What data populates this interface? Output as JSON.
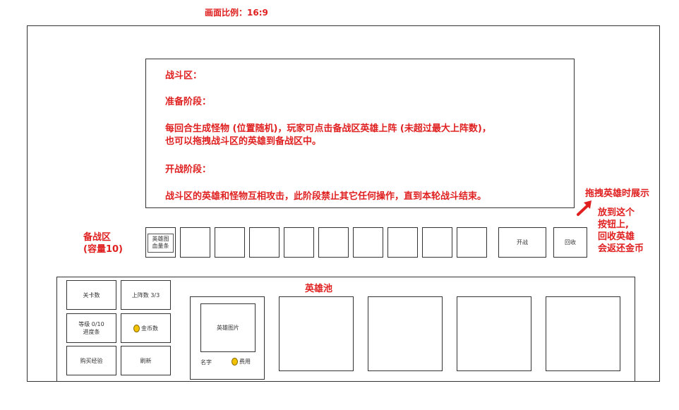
{
  "aspect_note": "画面比例：16:9",
  "battle_area": {
    "title": "战斗区：",
    "prep_heading": "准备阶段：",
    "prep_line1": "每回合生成怪物 (位置随机)，玩家可点击备战区英雄上阵 (未超过最大上阵数)，",
    "prep_line2": "也可以拖拽战斗区的英雄到备战区中。",
    "fight_heading": "开战阶段：",
    "fight_line": "战斗区的英雄和怪物互相攻击，此阶段禁止其它任何操作，直到本轮战斗结束。"
  },
  "bench": {
    "label_line1": "备战区",
    "label_line2": "(容量10)",
    "first_slot_line1": "英雄图",
    "first_slot_line2": "血量条",
    "start_button": "开战",
    "recycle_button": "回收"
  },
  "drag_note": {
    "title": "拖拽英雄时展示",
    "line1": "放到这个",
    "line2": "按钮上,",
    "line3": "回收英雄",
    "line4": "会返还金币",
    "accent": "#e02020"
  },
  "hero_pool": {
    "title": "英雄池",
    "card": {
      "image_label": "英雄图片",
      "name": "名字",
      "cost": "费用"
    }
  },
  "stats": {
    "level_count": "关卡数",
    "deploy": "上阵数 3/3",
    "grade_line1": "等级 0/10",
    "grade_line2": "进度条",
    "coins": "金币数",
    "buy_exp": "购买经验",
    "refresh": "刷新"
  }
}
